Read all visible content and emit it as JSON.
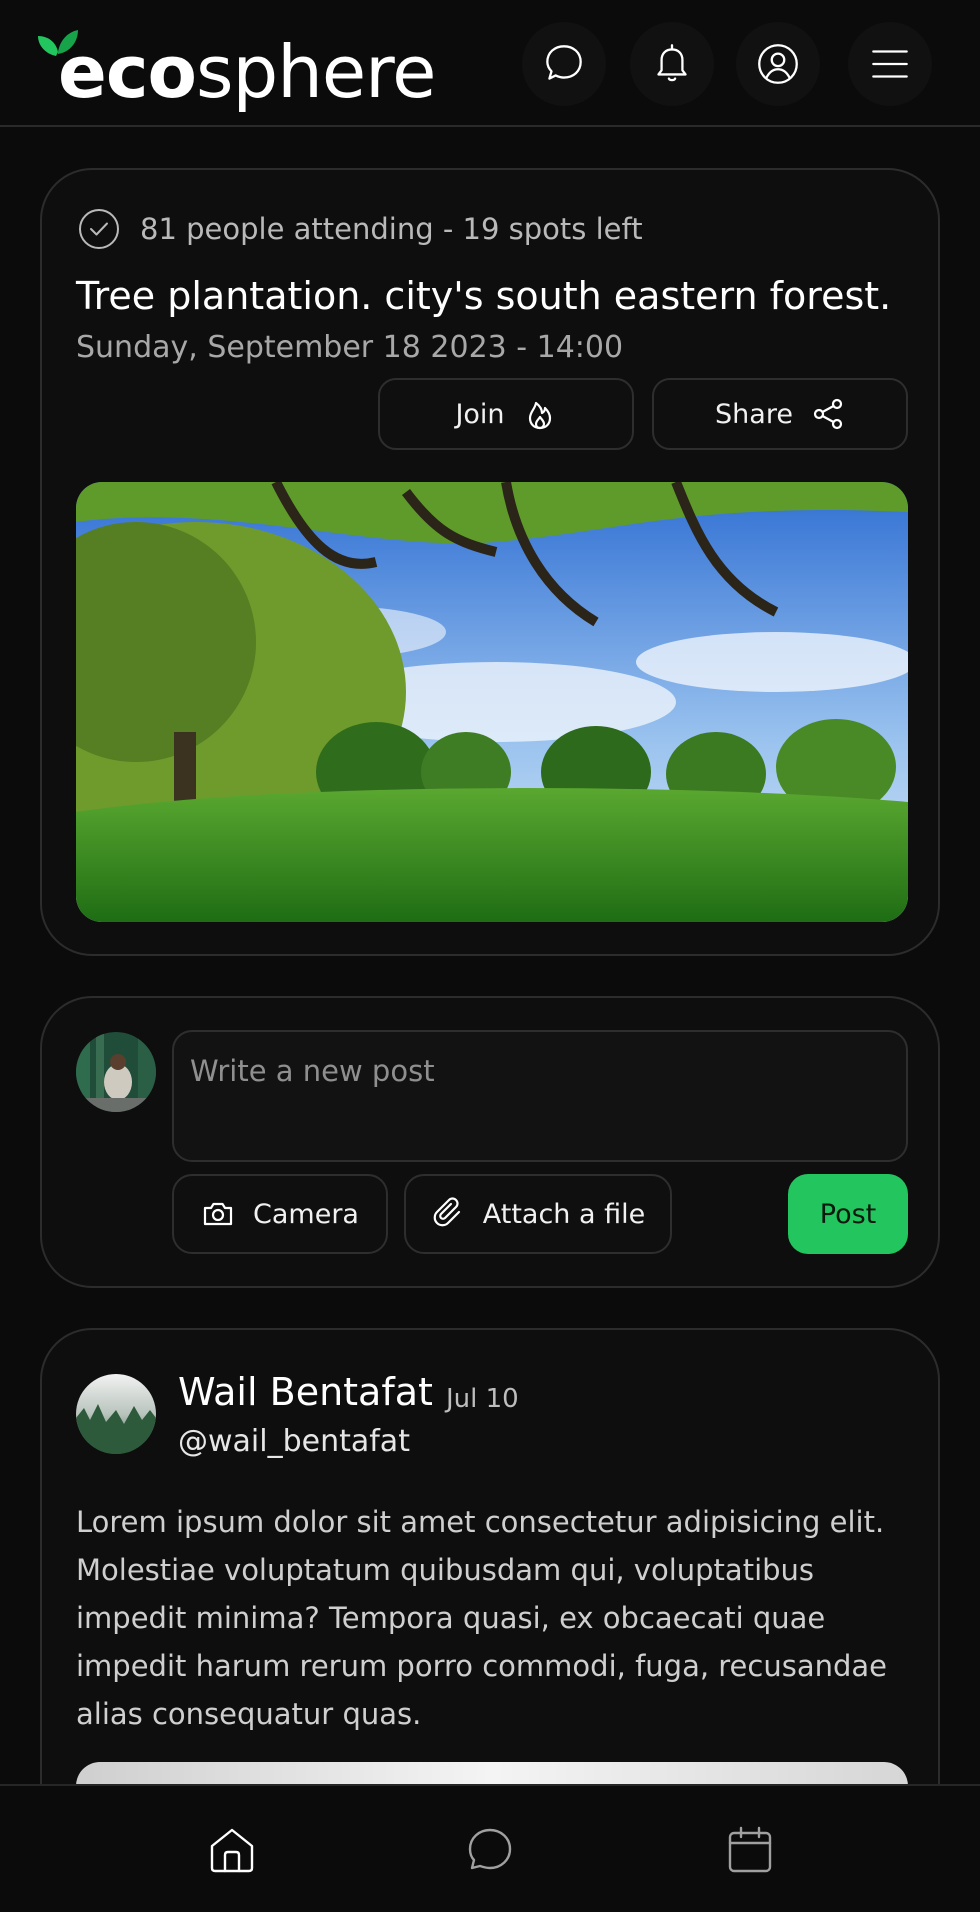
{
  "app": {
    "logo_bold": "eco",
    "logo_light": "sphere",
    "accent_color": "#22c55e"
  },
  "header": {
    "icons": [
      "chat-icon",
      "bell-icon",
      "user-circle-icon",
      "menu-icon"
    ]
  },
  "event": {
    "attendance": "81 people attending - 19 spots left",
    "title": "Tree plantation. city's south eastern forest.",
    "datetime": "Sunday, September 18 2023 - 14:00",
    "join_label": "Join",
    "share_label": "Share"
  },
  "compose": {
    "placeholder": "Write a new post",
    "camera_label": "Camera",
    "attach_label": "Attach a file",
    "post_label": "Post"
  },
  "post": {
    "author": "Wail Bentafat",
    "date": "Jul 10",
    "handle": "@wail_bentafat",
    "body": "Lorem ipsum dolor sit amet consectetur adipisicing elit. Molestiae voluptatum quibusdam qui, voluptatibus impedit minima? Tempora quasi, ex obcaecati quae impedit harum rerum porro commodi, fuga, recusandae alias consequatur quas."
  },
  "bottom_nav": {
    "items": [
      "home-icon",
      "chat-icon",
      "calendar-icon"
    ],
    "active_color": "#ffffff",
    "inactive_color": "#a0a0a0"
  }
}
